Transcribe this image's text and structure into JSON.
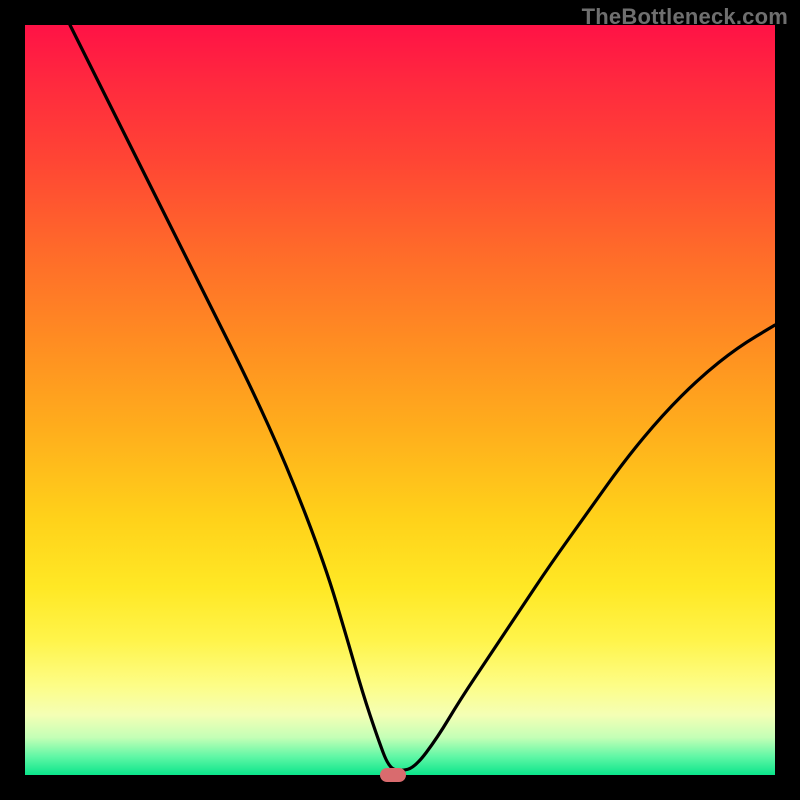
{
  "watermark": "TheBottleneck.com",
  "colors": {
    "page_bg": "#000000",
    "watermark_text": "#6f6f6f",
    "curve_stroke": "#000000",
    "marker_fill": "#d96b6e",
    "gradient_top": "#ff1246",
    "gradient_bottom": "#0be58b"
  },
  "chart_data": {
    "type": "line",
    "title": "",
    "xlabel": "",
    "ylabel": "",
    "xlim": [
      0,
      100
    ],
    "ylim": [
      0,
      100
    ],
    "grid": false,
    "legend": false,
    "marker": {
      "x": 49,
      "y": 0,
      "shape": "pill",
      "color": "#d96b6e"
    },
    "series": [
      {
        "name": "curve",
        "x": [
          6,
          10,
          15,
          20,
          25,
          30,
          35,
          40,
          43,
          45,
          47,
          48.5,
          50,
          52,
          55,
          58,
          62,
          66,
          70,
          75,
          80,
          85,
          90,
          95,
          100
        ],
        "y": [
          100,
          92,
          82,
          72,
          62,
          52,
          41,
          28,
          18,
          11,
          5,
          1,
          0.5,
          1,
          5,
          10,
          16,
          22,
          28,
          35,
          42,
          48,
          53,
          57,
          60
        ]
      }
    ]
  }
}
